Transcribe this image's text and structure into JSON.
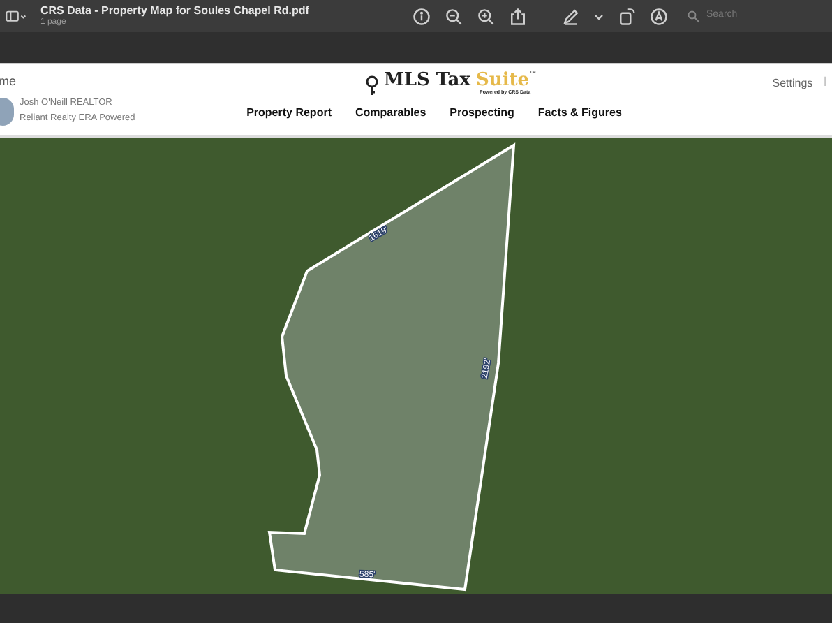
{
  "viewer": {
    "title": "CRS Data - Property Map for Soules Chapel Rd.pdf",
    "subtitle": "1 page",
    "search": {
      "placeholder": "Search"
    }
  },
  "header": {
    "home_link": "me",
    "logo": {
      "text": "MLS Tax",
      "accent": "Suite",
      "trademark": "™",
      "tagline": "Powered by CRS Data"
    },
    "user": {
      "name": "Josh O'Neill REALTOR",
      "company": "Reliant Realty ERA Powered"
    },
    "settings": "Settings",
    "separator": "|",
    "nav": [
      {
        "label": "Property Report"
      },
      {
        "label": "Comparables"
      },
      {
        "label": "Prospecting"
      },
      {
        "label": "Facts & Figures"
      }
    ]
  },
  "map": {
    "measurements": [
      {
        "text": "1619'"
      },
      {
        "text": "2192'"
      },
      {
        "text": "585'"
      }
    ]
  }
}
